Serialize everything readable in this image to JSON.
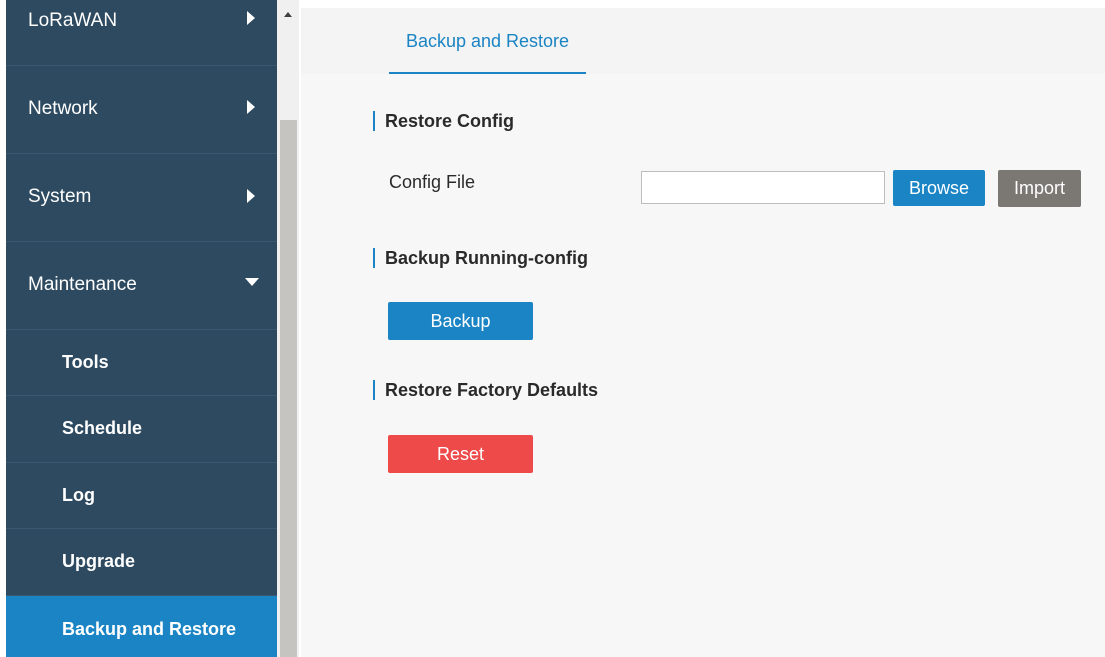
{
  "sidebar": {
    "items": [
      {
        "label": "LoRaWAN"
      },
      {
        "label": "Network"
      },
      {
        "label": "System"
      },
      {
        "label": "Maintenance"
      }
    ],
    "subitems": [
      {
        "label": "Tools"
      },
      {
        "label": "Schedule"
      },
      {
        "label": "Log"
      },
      {
        "label": "Upgrade"
      },
      {
        "label": "Backup and Restore"
      }
    ]
  },
  "tabs": [
    {
      "label": "Backup and Restore"
    }
  ],
  "sections": {
    "restore": {
      "title": "Restore Config",
      "field_label": "Config File",
      "file_value": "",
      "browse_label": "Browse",
      "import_label": "Import"
    },
    "backup": {
      "title": "Backup Running-config",
      "button_label": "Backup"
    },
    "factory": {
      "title": "Restore Factory Defaults",
      "button_label": "Reset"
    }
  },
  "colors": {
    "sidebar_bg": "#2d4a60",
    "accent": "#1a84c4",
    "danger": "#ee4a4a",
    "neutral_button": "#7b7874"
  }
}
